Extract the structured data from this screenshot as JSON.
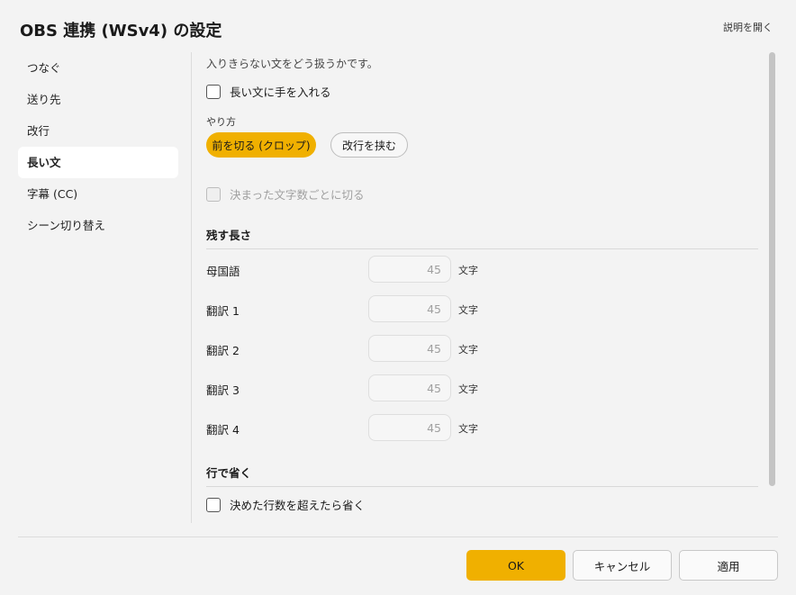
{
  "header": {
    "title": "OBS 連携 (WSv4) の設定",
    "help_link": "説明を開く"
  },
  "sidebar": {
    "items": [
      {
        "label": "つなぐ"
      },
      {
        "label": "送り先"
      },
      {
        "label": "改行"
      },
      {
        "label": "長い文",
        "active": true
      },
      {
        "label": "字幕 (CC)"
      },
      {
        "label": "シーン切り替え"
      }
    ]
  },
  "content": {
    "description": "入りきらない文をどう扱うかです。",
    "handle_long_text": {
      "label": "長い文に手を入れる",
      "checked": false
    },
    "method": {
      "label": "やり方",
      "options": [
        {
          "label": "前を切る (クロップ)",
          "selected": true
        },
        {
          "label": "改行を挟む",
          "selected": false
        }
      ]
    },
    "cut_by_chars": {
      "label": "決まった文字数ごとに切る",
      "checked": false,
      "disabled": true
    },
    "keep_length": {
      "heading": "残す長さ",
      "unit": "文字",
      "rows": [
        {
          "label": "母国語",
          "value": "45"
        },
        {
          "label": "翻訳 1",
          "value": "45"
        },
        {
          "label": "翻訳 2",
          "value": "45"
        },
        {
          "label": "翻訳 3",
          "value": "45"
        },
        {
          "label": "翻訳 4",
          "value": "45"
        }
      ]
    },
    "omit_by_lines": {
      "heading": "行で省く",
      "checkbox": {
        "label": "決めた行数を超えたら省く",
        "checked": false
      }
    }
  },
  "footer": {
    "ok": "OK",
    "cancel": "キャンセル",
    "apply": "適用"
  },
  "colors": {
    "accent": "#f0b000",
    "background": "#f3f3f3",
    "active_nav": "#ffffff"
  }
}
